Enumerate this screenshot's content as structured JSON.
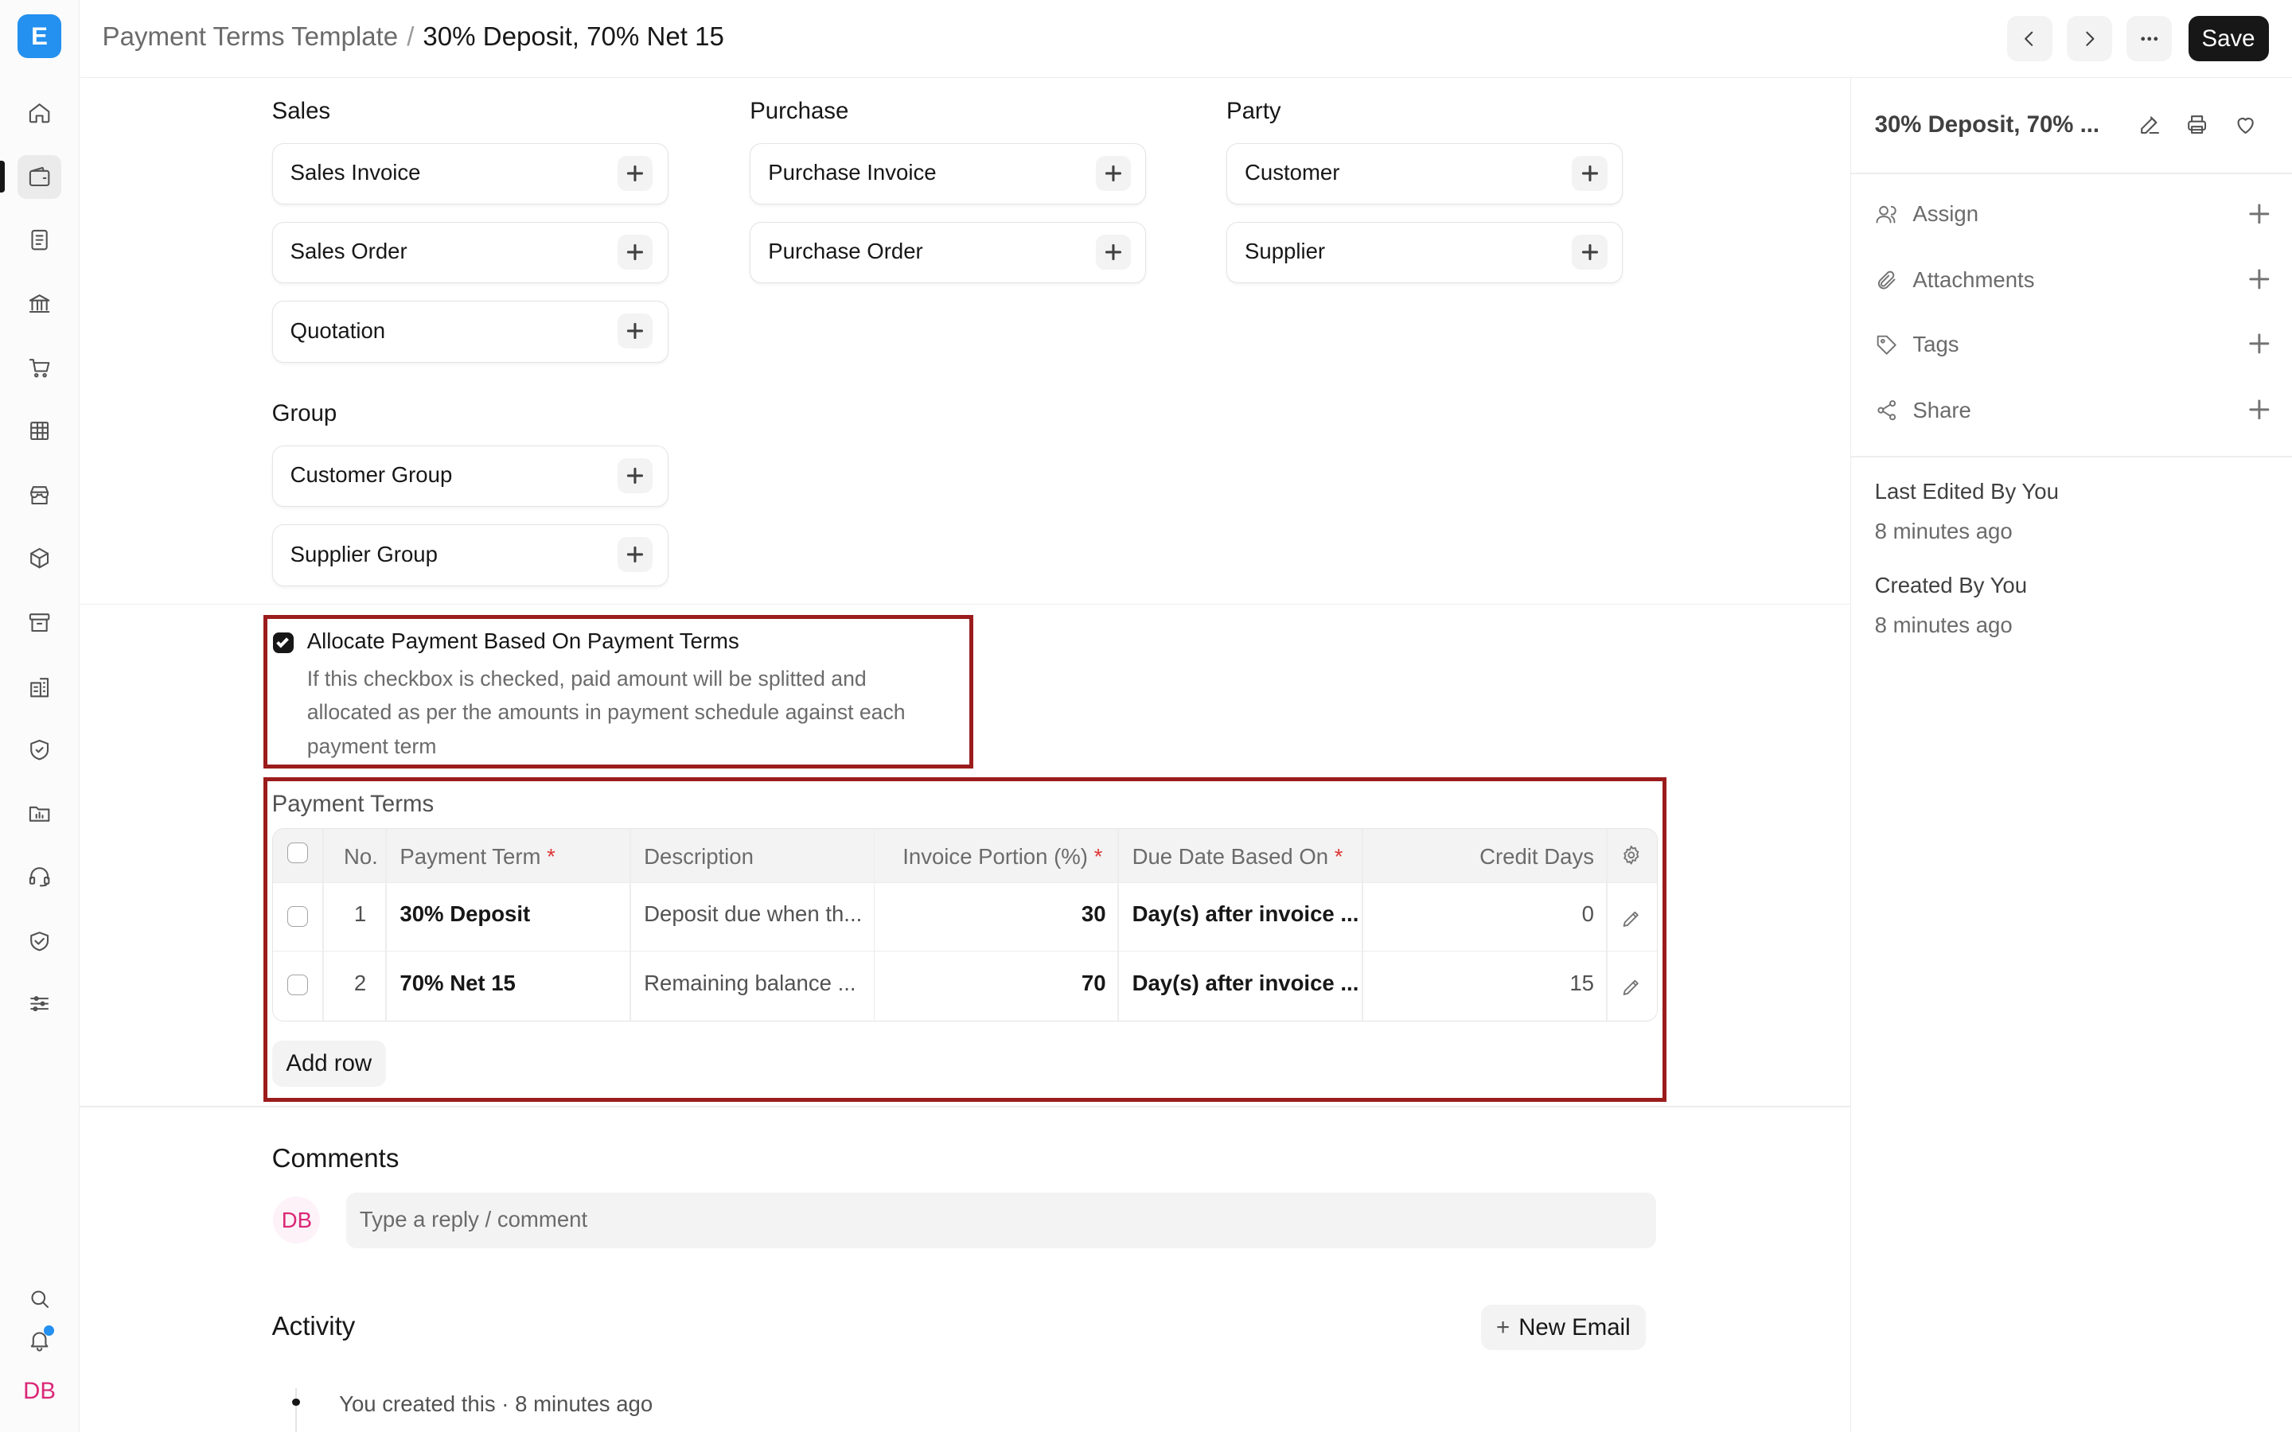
{
  "app": {
    "logo_letter": "E",
    "user_initials": "DB"
  },
  "breadcrumb": {
    "parent": "Payment Terms Template",
    "separator": "/",
    "current": "30% Deposit, 70% Net 15"
  },
  "toolbar": {
    "save_label": "Save"
  },
  "links": {
    "sales": {
      "title": "Sales",
      "items": [
        "Sales Invoice",
        "Sales Order",
        "Quotation"
      ]
    },
    "purchase": {
      "title": "Purchase",
      "items": [
        "Purchase Invoice",
        "Purchase Order"
      ]
    },
    "party": {
      "title": "Party",
      "items": [
        "Customer",
        "Supplier"
      ]
    },
    "group": {
      "title": "Group",
      "items": [
        "Customer Group",
        "Supplier Group"
      ]
    }
  },
  "allocate": {
    "label": "Allocate Payment Based On Payment Terms",
    "checked": true,
    "description": "If this checkbox is checked, paid amount will be splitted and allocated as per the amounts in payment schedule against each payment term"
  },
  "payment_terms": {
    "title": "Payment Terms",
    "columns": [
      "No.",
      "Payment Term",
      "Description",
      "Invoice Portion (%)",
      "Due Date Based On",
      "Credit Days"
    ],
    "required_marker": "*",
    "rows": [
      {
        "no": "1",
        "term": "30% Deposit",
        "description": "Deposit due when th...",
        "portion": "30",
        "due": "Day(s) after invoice ...",
        "credit_days": "0"
      },
      {
        "no": "2",
        "term": "70% Net 15",
        "description": "Remaining balance ...",
        "portion": "70",
        "due": "Day(s) after invoice ...",
        "credit_days": "15"
      }
    ],
    "add_row_label": "Add row"
  },
  "comments": {
    "title": "Comments",
    "placeholder": "Type a reply / comment",
    "avatar": "DB"
  },
  "activity": {
    "title": "Activity",
    "new_email_label": "New Email",
    "plus": "+",
    "entries": [
      "You created this · 8 minutes ago"
    ]
  },
  "sidebar": {
    "title": "30% Deposit, 70% ...",
    "items": [
      {
        "label": "Assign",
        "icon": "user-icon"
      },
      {
        "label": "Attachments",
        "icon": "paperclip-icon"
      },
      {
        "label": "Tags",
        "icon": "tag-icon"
      },
      {
        "label": "Share",
        "icon": "share-icon"
      }
    ],
    "last_edited": "Last Edited By You",
    "last_edited_time": "8 minutes ago",
    "created": "Created By You",
    "created_time": "8 minutes ago"
  },
  "colors": {
    "accent": "#2490ef",
    "highlight": "#9b1c1c",
    "primary_button": "#171717",
    "required": "#e03636"
  }
}
